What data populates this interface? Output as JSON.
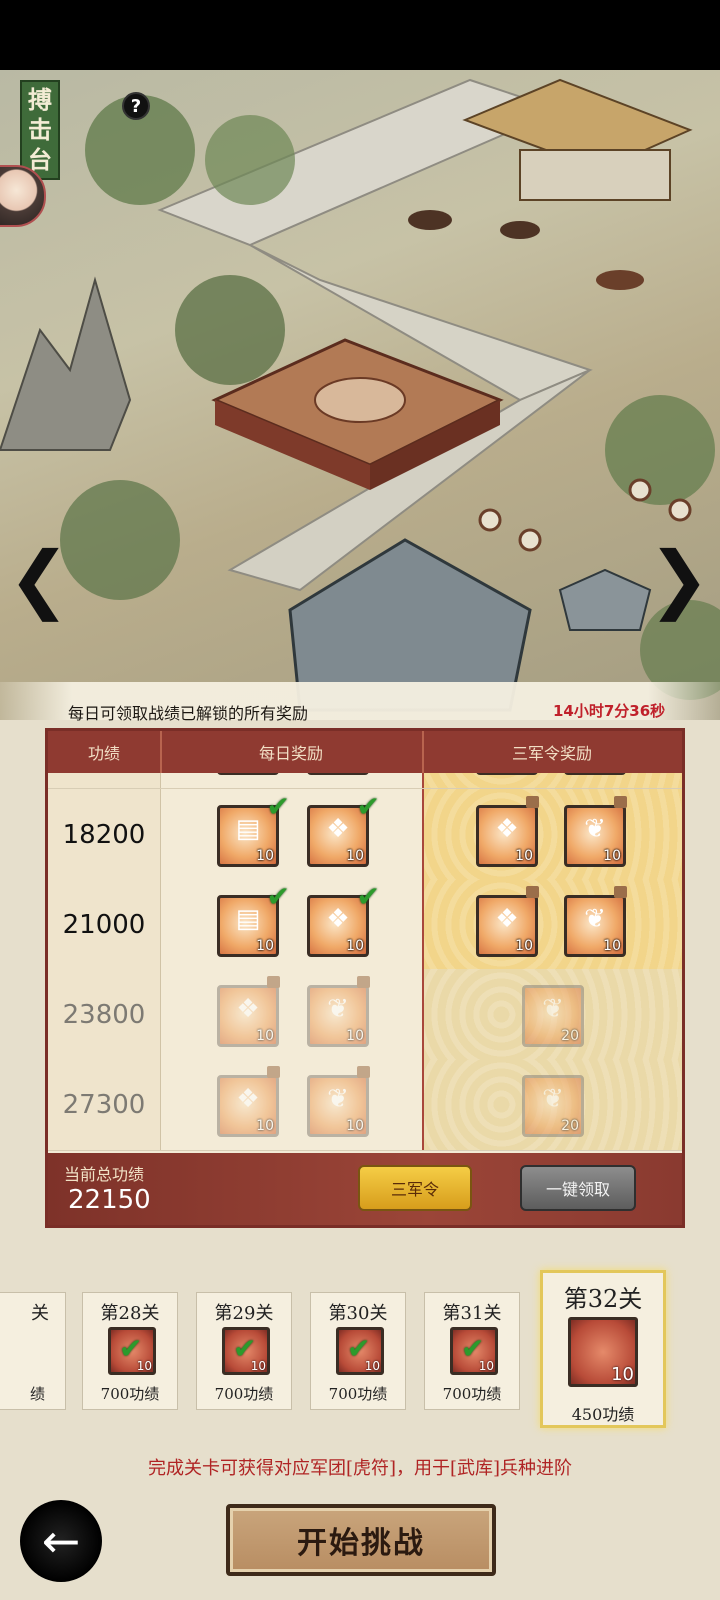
{
  "scene": {
    "title_chars": [
      "搏",
      "击",
      "台"
    ],
    "help_glyph": "?",
    "nav_left_glyph": "❮",
    "nav_right_glyph": "❯",
    "notice": "每日可领取战绩已解锁的所有奖励",
    "countdown": "14小时7分36秒"
  },
  "panel": {
    "headers": {
      "score": "功绩",
      "daily": "每日奖励",
      "premium": "三军令奖励"
    },
    "rows": [
      {
        "score": "18200",
        "daily": [
          {
            "qty": "10",
            "icon": "armor-icon",
            "claimed": true
          },
          {
            "qty": "10",
            "icon": "talisman-icon",
            "claimed": true
          }
        ],
        "premium": [
          {
            "qty": "10",
            "icon": "talisman-icon",
            "locked": true
          },
          {
            "qty": "10",
            "icon": "boots-icon",
            "locked": true
          }
        ]
      },
      {
        "score": "21000",
        "daily": [
          {
            "qty": "10",
            "icon": "armor-icon",
            "claimed": true
          },
          {
            "qty": "10",
            "icon": "talisman-icon",
            "claimed": true
          }
        ],
        "premium": [
          {
            "qty": "10",
            "icon": "talisman-icon",
            "locked": true
          },
          {
            "qty": "10",
            "icon": "boots-icon",
            "locked": true
          }
        ]
      },
      {
        "score": "23800",
        "locked": true,
        "daily": [
          {
            "qty": "10",
            "icon": "talisman-icon",
            "locked": true
          },
          {
            "qty": "10",
            "icon": "boots-icon",
            "locked": true
          }
        ],
        "premium": [
          {
            "qty": "20",
            "icon": "boots-icon"
          }
        ]
      },
      {
        "score": "27300",
        "locked": true,
        "daily": [
          {
            "qty": "10",
            "icon": "talisman-icon",
            "locked": true
          },
          {
            "qty": "10",
            "icon": "boots-icon",
            "locked": true
          }
        ],
        "premium": [
          {
            "qty": "20",
            "icon": "boots-icon"
          }
        ]
      }
    ],
    "footer": {
      "total_label": "当前总功绩",
      "total_value": "22150",
      "sanjun_button": "三军令",
      "claim_button": "一键领取"
    }
  },
  "stages": [
    {
      "title": "关",
      "reward": "绩",
      "qty": "",
      "partial": true
    },
    {
      "title": "第28关",
      "reward": "700功绩",
      "qty": "10",
      "done": true
    },
    {
      "title": "第29关",
      "reward": "700功绩",
      "qty": "10",
      "done": true
    },
    {
      "title": "第30关",
      "reward": "700功绩",
      "qty": "10",
      "done": true
    },
    {
      "title": "第31关",
      "reward": "700功绩",
      "qty": "10",
      "done": true
    },
    {
      "title": "第32关",
      "reward": "450功绩",
      "qty": "10",
      "current": true
    }
  ],
  "hint": "完成关卡可获得对应军团[虎符]，用于[武库]兵种进阶",
  "back_glyph": "←",
  "start_button": "开始挑战",
  "colors": {
    "accent_red": "#8f3a31",
    "gold": "#f5cd46",
    "claimed_green": "#2c9a2c",
    "hint_red": "#b02424"
  }
}
